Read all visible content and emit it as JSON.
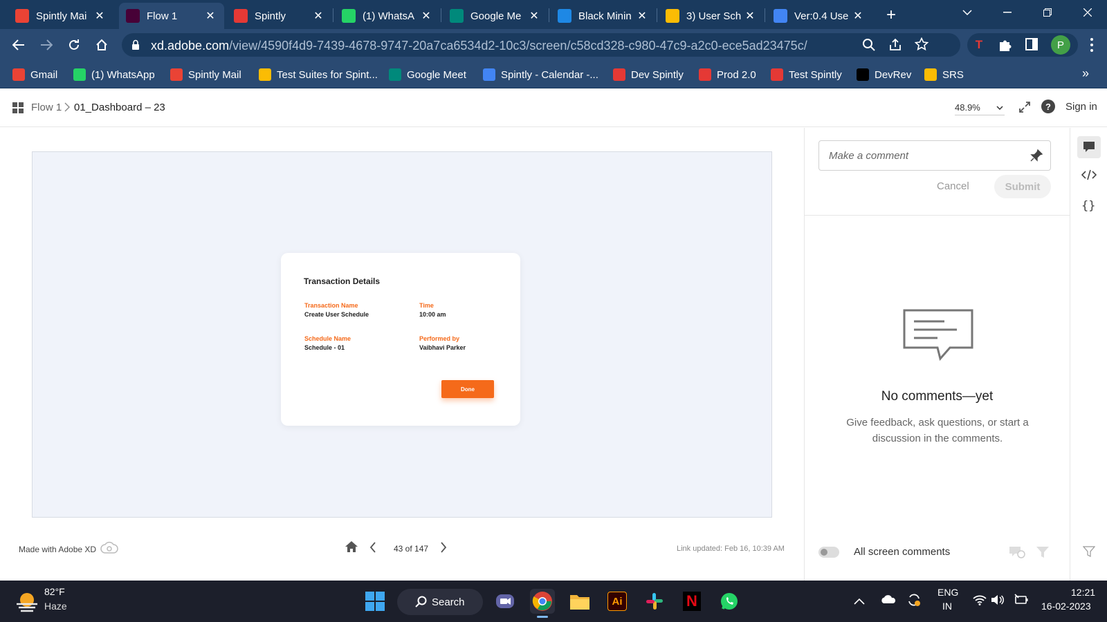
{
  "browser": {
    "tabs": [
      {
        "title": "Spintly Mai",
        "icon": "gmail-icon",
        "color": "#ea4335",
        "active": false
      },
      {
        "title": "Flow 1",
        "icon": "adobe-xd-icon",
        "color": "#470137",
        "active": true
      },
      {
        "title": "Spintly",
        "icon": "wifi-icon",
        "color": "#e53935",
        "active": false
      },
      {
        "title": "(1) WhatsA",
        "icon": "whatsapp-icon",
        "color": "#25d366",
        "active": false
      },
      {
        "title": "Google Me",
        "icon": "google-meet-icon",
        "color": "#00897b",
        "active": false
      },
      {
        "title": "Black Minin",
        "icon": "canva-icon",
        "color": "#1e88e5",
        "active": false
      },
      {
        "title": "3) User Sch",
        "icon": "google-drive-icon",
        "color": "#fbbc04",
        "active": false
      },
      {
        "title": "Ver:0.4 Use",
        "icon": "google-docs-icon",
        "color": "#4285f4",
        "active": false
      }
    ],
    "new_tab": "+",
    "url_host": "xd.adobe.com",
    "url_path": "/view/4590f4d9-7439-4678-9747-20a7ca6534d2-10c3/screen/c58cd328-c980-47c9-a2c0-ece5ad23475c/",
    "profile_initial": "P",
    "profile_color": "#43a047",
    "bookmarks": [
      {
        "label": "Gmail",
        "icon": "gmail-icon",
        "color": "#ea4335"
      },
      {
        "label": "(1) WhatsApp",
        "icon": "whatsapp-icon",
        "color": "#25d366"
      },
      {
        "label": "Spintly Mail",
        "icon": "mail-icon",
        "color": "#ea4335"
      },
      {
        "label": "Test Suites for Spint...",
        "icon": "google-drive-icon",
        "color": "#fbbc04"
      },
      {
        "label": "Google Meet",
        "icon": "google-meet-icon",
        "color": "#00897b"
      },
      {
        "label": "Spintly - Calendar -...",
        "icon": "calendar-icon",
        "color": "#4285f4"
      },
      {
        "label": "Dev Spintly",
        "icon": "wifi-icon",
        "color": "#e53935"
      },
      {
        "label": "Prod 2.0",
        "icon": "wifi-icon",
        "color": "#e53935"
      },
      {
        "label": "Test Spintly",
        "icon": "wifi-icon",
        "color": "#e53935"
      },
      {
        "label": "DevRev",
        "icon": "devrev-icon",
        "color": "#000000"
      },
      {
        "label": "SRS",
        "icon": "google-drive-icon",
        "color": "#fbbc04"
      }
    ],
    "more_bookmarks": "»"
  },
  "xd": {
    "breadcrumb_root": "Flow 1",
    "breadcrumb_current": "01_Dashboard – 23",
    "zoom": "48.9%",
    "sign_in": "Sign in",
    "made_with": "Made with Adobe XD",
    "page_indicator": "43 of 147",
    "link_updated": "Link updated: Feb 16, 10:39 AM",
    "accent_color": "#f56a1a"
  },
  "transaction": {
    "title": "Transaction Details",
    "fields": [
      {
        "label": "Transaction Name",
        "value": "Create User Schedule"
      },
      {
        "label": "Time",
        "value": "10:00 am"
      },
      {
        "label": "Schedule Name",
        "value": "Schedule - 01"
      },
      {
        "label": "Performed by",
        "value": "Vaibhavi Parker"
      }
    ],
    "done_label": "Done"
  },
  "comments": {
    "placeholder": "Make a comment",
    "cancel": "Cancel",
    "submit": "Submit",
    "empty_title": "No comments—yet",
    "empty_body": "Give feedback, ask questions, or start a discussion in the comments.",
    "toggle_label": "All screen comments"
  },
  "taskbar": {
    "weather_temp": "82°F",
    "weather_desc": "Haze",
    "search_label": "Search",
    "lang_top": "ENG",
    "lang_bottom": "IN",
    "time": "12:21",
    "date": "16-02-2023"
  }
}
